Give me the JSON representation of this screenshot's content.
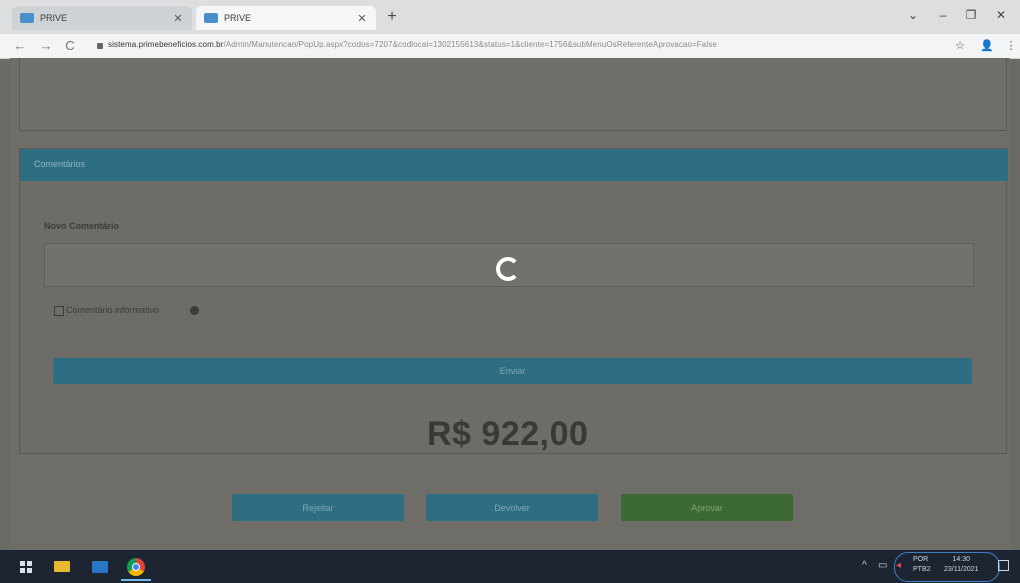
{
  "browser": {
    "tabs": [
      {
        "title": "PRIVE",
        "active": false
      },
      {
        "title": "PRIVE",
        "active": true
      }
    ],
    "new_tab": "+",
    "controls": {
      "dropdown": "⌄",
      "minimize": "–",
      "restore": "❐",
      "close": "✕"
    },
    "nav": {
      "back": "←",
      "forward": "→",
      "reload": "C"
    },
    "url_host": "sistema.primebeneficios.com.br",
    "url_path": "/Admin/Manutencao/PopUp.aspx?codos=7207&codlocal=1302155613&status=1&cliente=1756&subMenuOsReferenteAprovacao=False",
    "star": "☆",
    "profile": "👤",
    "menu": "⋮"
  },
  "page": {
    "panel_header": "Comentários",
    "novo_comentario_label": "Novo Comentário",
    "checkbox_label": "Comentário informativo",
    "enviar_label": "Enviar",
    "price": "R$ 922,00",
    "actions": {
      "rejeitar": "Rejeitar",
      "devolver": "Devolver",
      "aprovar": "Aprovar"
    }
  },
  "taskbar": {
    "tray_chevron": "^",
    "lang_1": "POR",
    "lang_2": "PTB2",
    "time": "14:30",
    "date": "23/11/2021"
  },
  "colors": {
    "primary_blue_dimmed": "#2e6e83",
    "approve_green_dimmed": "#3d6a33",
    "overlay_gray": "#6e6d68",
    "spinner": "#ffffff"
  }
}
